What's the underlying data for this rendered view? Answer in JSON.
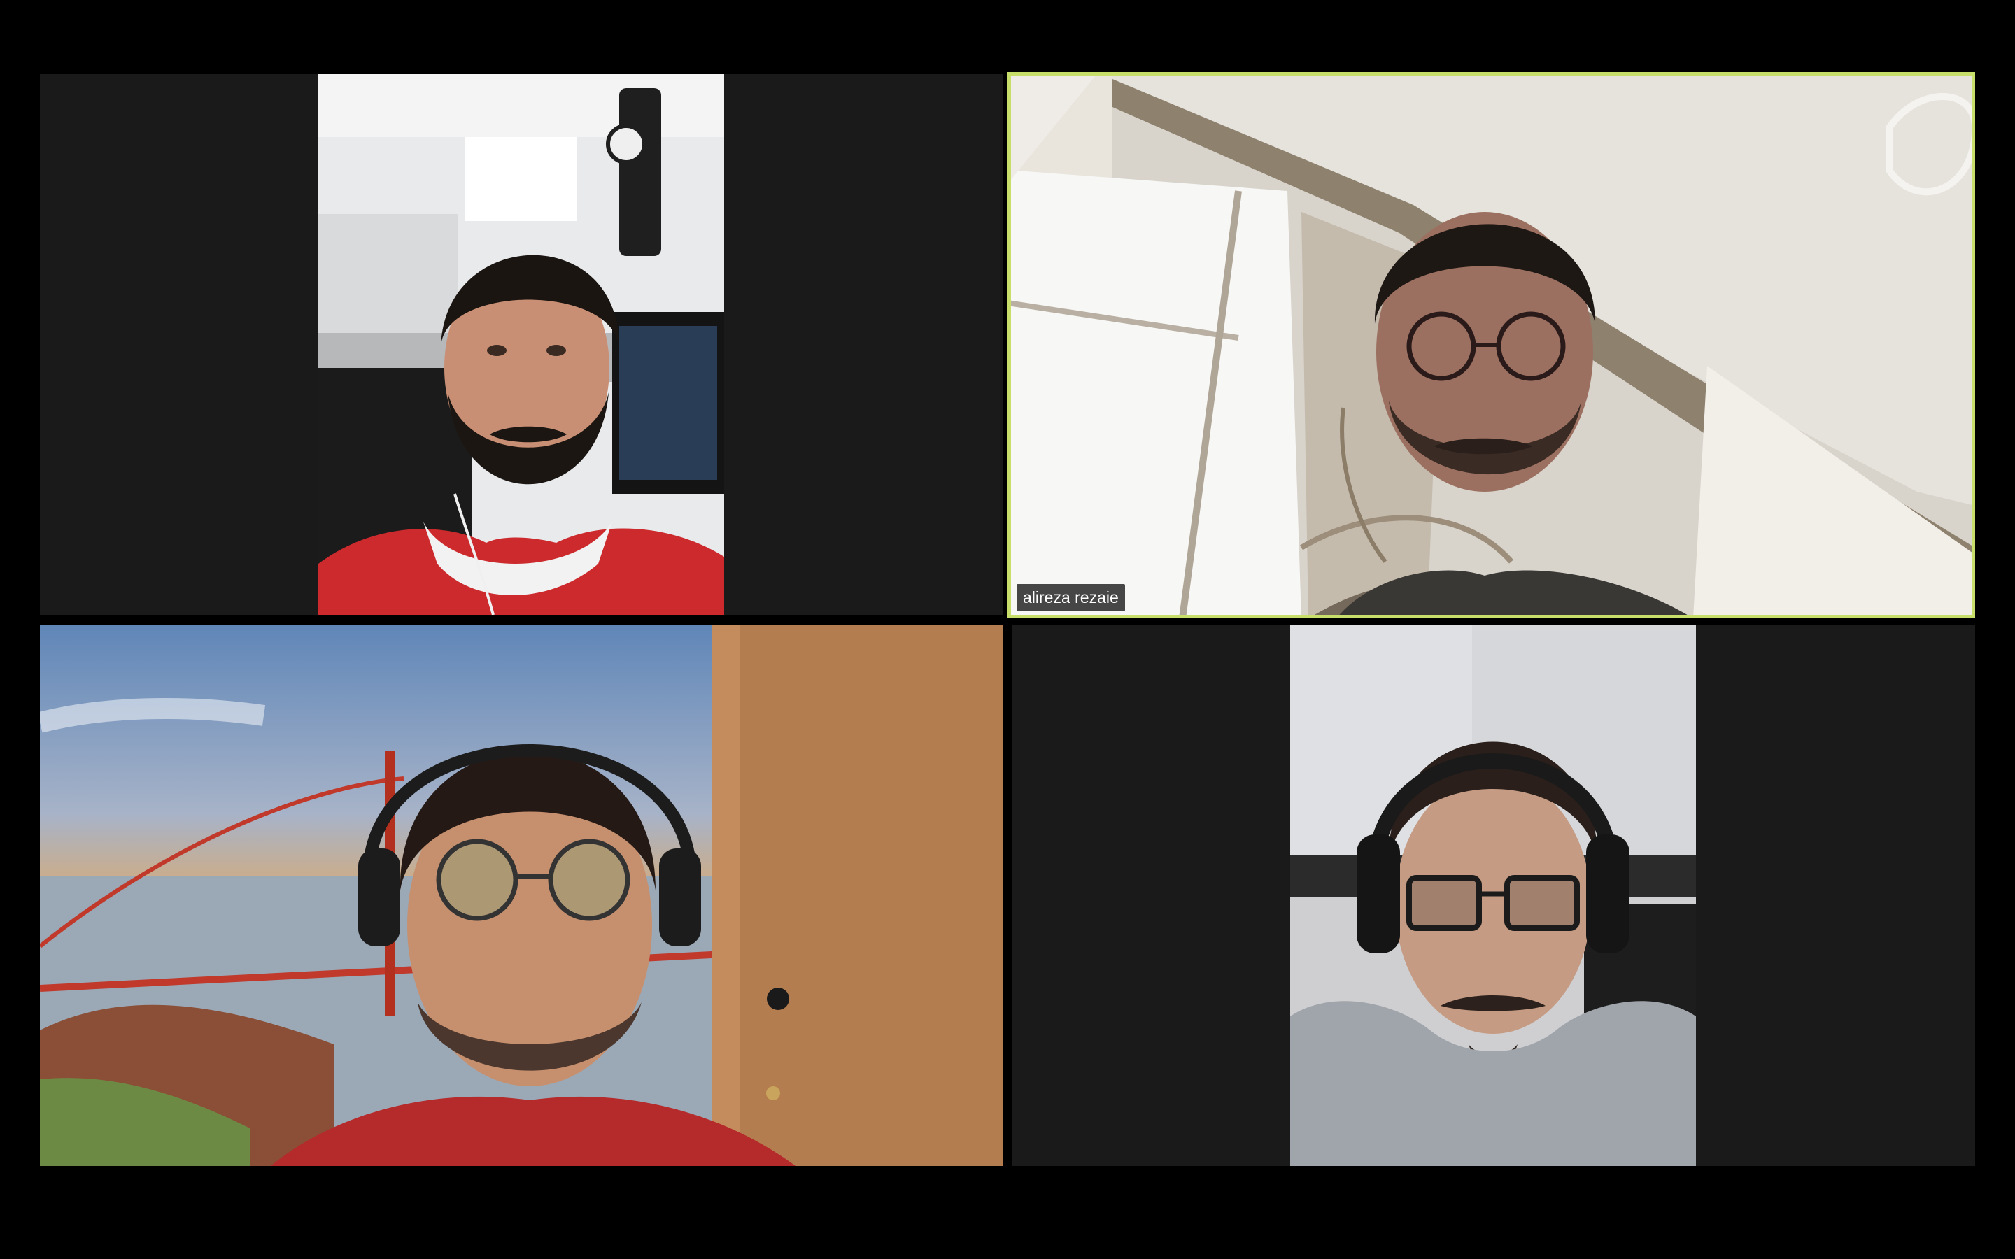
{
  "window": {
    "background": "#000000",
    "tile_background": "#1a1a1a",
    "active_speaker_color": "#c7df6a"
  },
  "participants": [
    {
      "label": "",
      "shirt": "red",
      "headphones": "none",
      "active": false
    },
    {
      "label": "alireza rezaie",
      "shirt": "dark",
      "headphones": "earphones",
      "active": true
    },
    {
      "label": "",
      "shirt": "red",
      "headphones": "over-ear",
      "background": "virtual-golden-gate-bridge",
      "active": false
    },
    {
      "label": "",
      "shirt": "gray",
      "headphones": "over-ear",
      "active": false
    }
  ]
}
